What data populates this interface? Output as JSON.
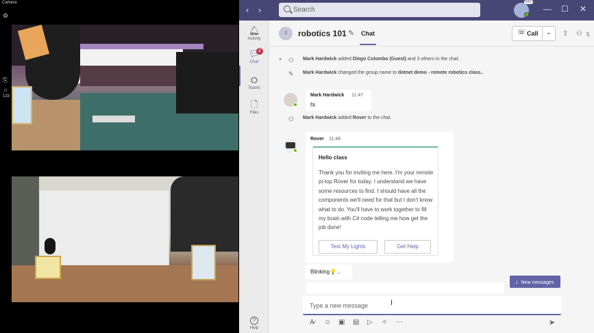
{
  "camera": {
    "title": "Camera",
    "count": "133",
    "icons": [
      "gear-icon",
      "camera-switch-icon",
      "brightness-icon"
    ]
  },
  "topbar": {
    "search_placeholder": "Search",
    "avatar_badge": "MS",
    "back_glyph": "‹",
    "forward_glyph": "›",
    "minimize_glyph": "—",
    "maximize_glyph": "☐",
    "close_glyph": "✕"
  },
  "rail": {
    "items": [
      {
        "label": "Activity",
        "icon": "bell-icon"
      },
      {
        "label": "Chat",
        "icon": "chat-icon",
        "badge": "2"
      },
      {
        "label": "Teams",
        "icon": "teams-icon"
      },
      {
        "label": "Files",
        "icon": "files-icon"
      }
    ],
    "help_label": "Help"
  },
  "header": {
    "group_initial": "J",
    "title": "robotics 101",
    "tab": "Chat",
    "call_label": "Call",
    "people_count": "5"
  },
  "messages": {
    "sys1": {
      "actor": "Mark Hardwick",
      "text1": " added ",
      "target": "Diego Colombo (Guest)",
      "text2": " and 3 others to the chat."
    },
    "sys2": {
      "actor": "Mark Hardwick",
      "text1": " changed the group name to ",
      "target": "dotnet demo - remote robotics class.."
    },
    "msg1": {
      "sender": "Mark Hardwick",
      "time": "11:47",
      "text": "hi"
    },
    "sys3": {
      "actor": "Mark Hardwick",
      "text1": " added ",
      "target": "Rover",
      "text2": " to the chat."
    },
    "msg2": {
      "sender": "Rover",
      "time": "11:48",
      "card_title": "Hello class",
      "card_body": "Thank you for inviting me here. I'm your remote pi-top Rover for today. I understand we have some resources to find. I should have all the components we'll need for that but I don't know what to do. You'll have to work together to fill my brain with C# code telling me how get the job done!",
      "button1": "Test My Lights",
      "button2": "Get Help"
    },
    "msg3": {
      "text": "Blinking",
      "emoji": "💡",
      "ellipsis": "..."
    }
  },
  "new_messages_label": "New messages",
  "compose": {
    "placeholder": "Type a new message"
  },
  "colors": {
    "accent": "#6264a7",
    "topbar": "#464775",
    "online": "#6bb700",
    "badge": "#c4314b"
  }
}
